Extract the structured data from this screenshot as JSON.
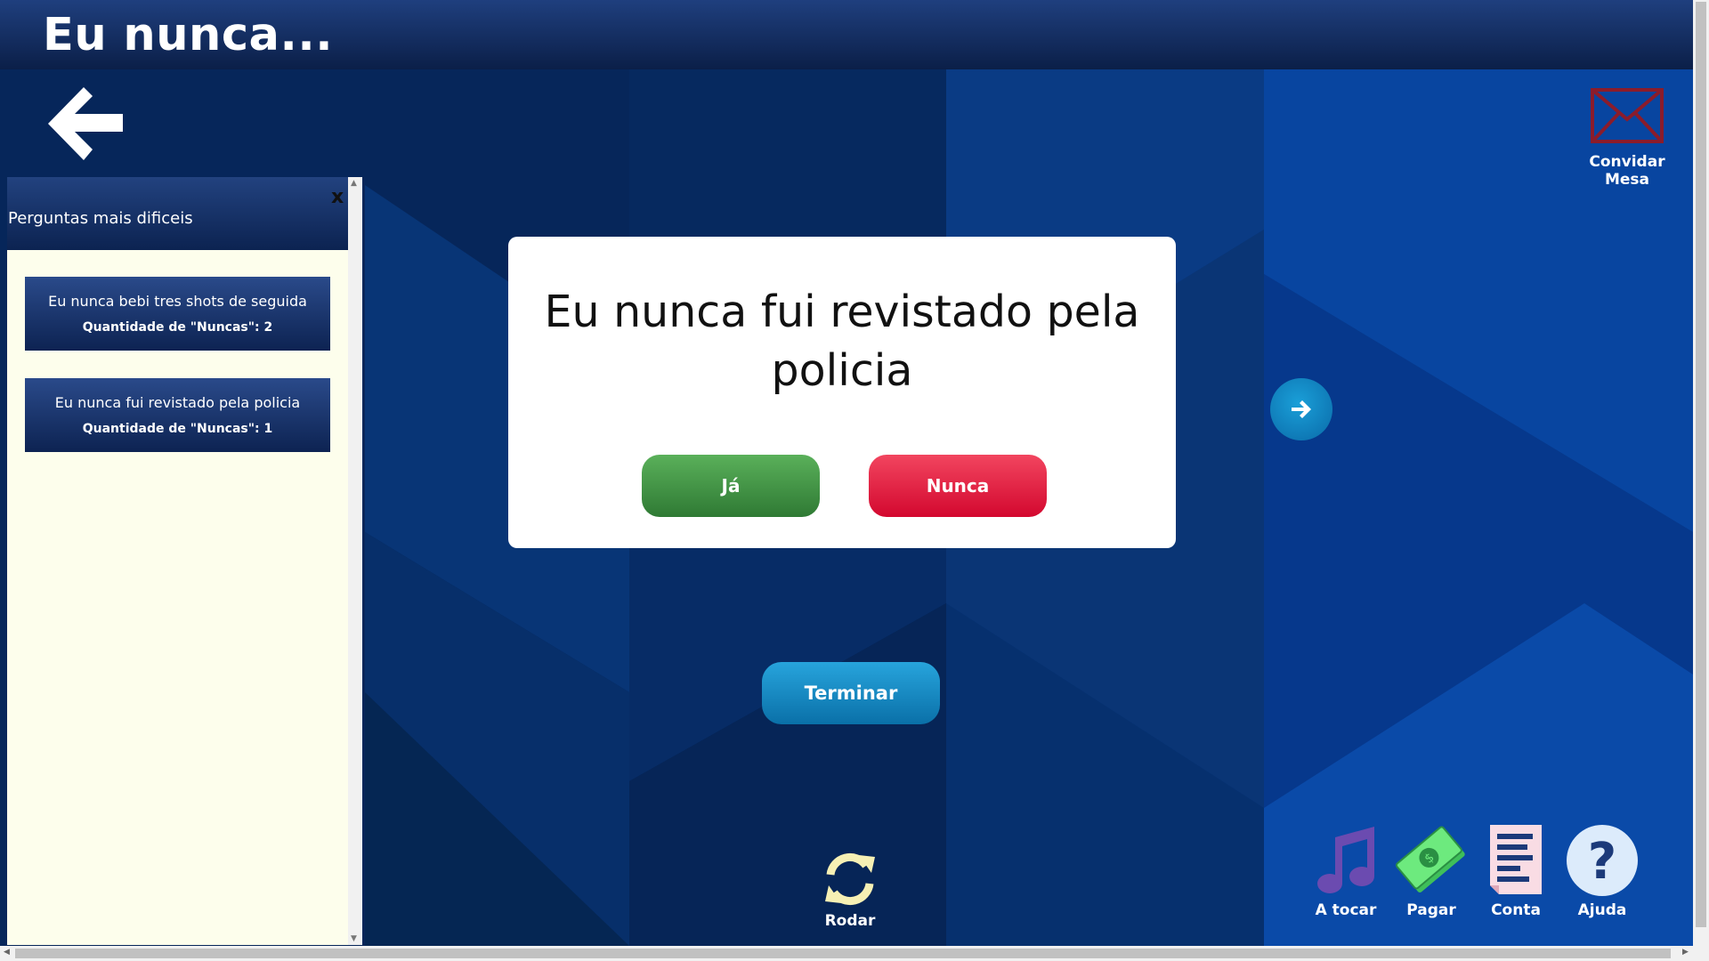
{
  "header": {
    "title": "Eu nunca..."
  },
  "invite": {
    "label": "Convidar Mesa"
  },
  "sidebar": {
    "title": "Perguntas mais dificeis",
    "close": "x",
    "cards": [
      {
        "question": "Eu nunca bebi tres shots de seguida",
        "count": "Quantidade de \"Nuncas\": 2"
      },
      {
        "question": "Eu nunca fui revistado pela policia",
        "count": "Quantidade de \"Nuncas\": 1"
      }
    ]
  },
  "modal": {
    "question": "Eu nunca fui revistado pela policia",
    "yes_label": "Já",
    "no_label": "Nunca"
  },
  "actions": {
    "finish_label": "Terminar",
    "spin_label": "Rodar"
  },
  "toolbar": {
    "music_label": "A tocar",
    "pay_label": "Pagar",
    "bill_label": "Conta",
    "help_label": "Ajuda"
  },
  "colors": {
    "header": "#1a3770",
    "yes": "#3f9445",
    "no": "#e51a3d",
    "accent_blue": "#1592cf",
    "sidebar_bg": "#fdfeec"
  },
  "icons": {
    "back": "arrow-left-icon",
    "invite": "envelope-icon",
    "next": "arrow-right-icon",
    "spin": "refresh-icon",
    "music": "music-note-icon",
    "pay": "money-icon",
    "bill": "receipt-icon",
    "help": "question-icon"
  }
}
